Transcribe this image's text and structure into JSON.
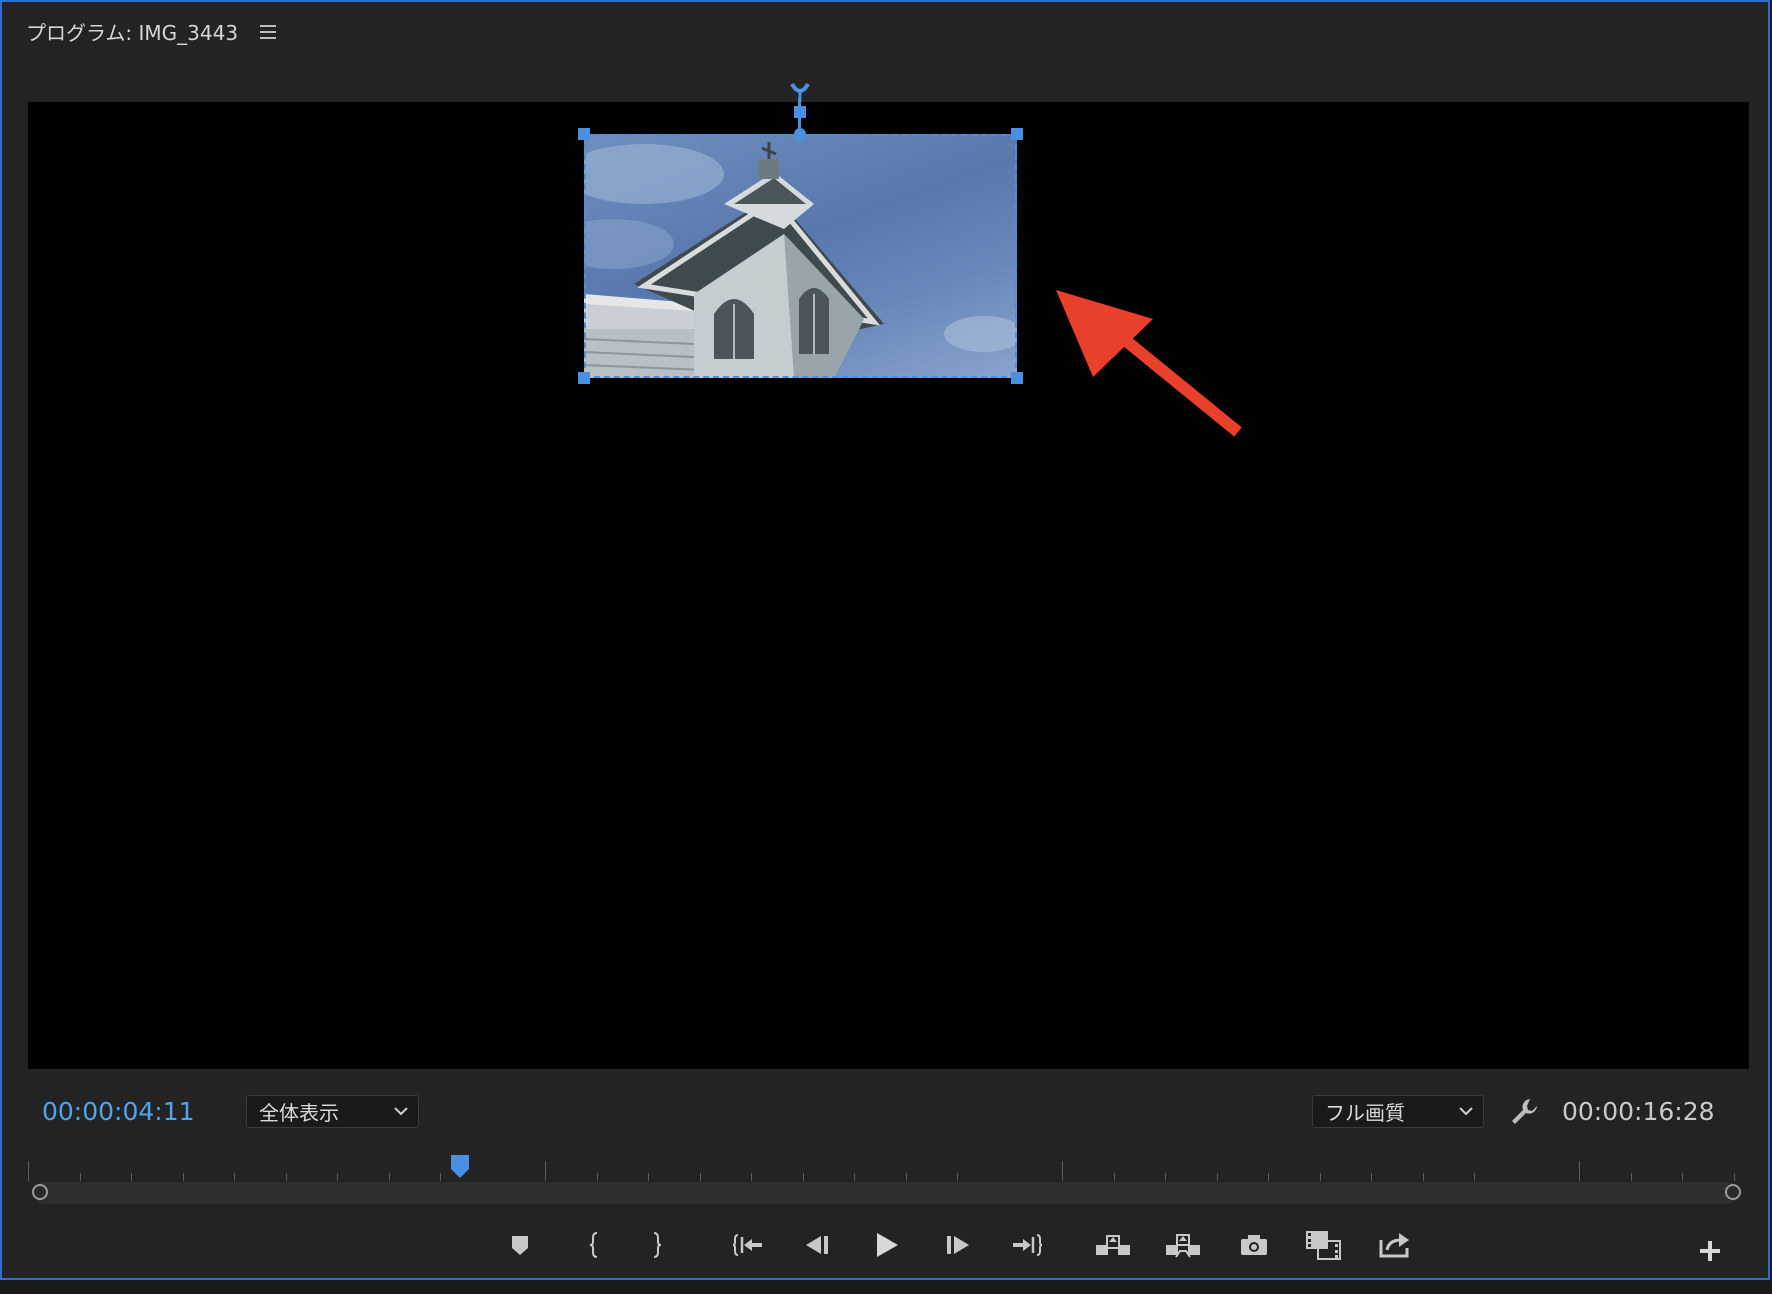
{
  "panel": {
    "title": "プログラム: IMG_3443",
    "menu_icon": "hamburger-menu-icon"
  },
  "viewer": {
    "clip_description_icon": "clock-tower-photo",
    "selection_color": "#4a90e2",
    "arrow_color": "#e8402a"
  },
  "controls": {
    "current_timecode": "00:00:04:11",
    "zoom_select": "全体表示",
    "quality_select": "フル画質",
    "duration_timecode": "00:00:16:28",
    "settings_icon": "wrench-icon",
    "timecode_color": "#4ea4ee"
  },
  "timeline": {
    "playhead_fraction": 0.25
  },
  "transport": {
    "buttons": [
      {
        "name": "marker-icon"
      },
      {
        "name": "mark-in-icon"
      },
      {
        "name": "mark-out-icon"
      },
      {
        "name": "go-to-in-icon"
      },
      {
        "name": "step-back-icon"
      },
      {
        "name": "play-icon"
      },
      {
        "name": "step-forward-icon"
      },
      {
        "name": "go-to-out-icon"
      },
      {
        "name": "lift-icon"
      },
      {
        "name": "extract-icon"
      },
      {
        "name": "export-frame-icon"
      },
      {
        "name": "comparison-view-icon"
      },
      {
        "name": "export-icon"
      },
      {
        "name": "add-button-icon"
      }
    ]
  }
}
